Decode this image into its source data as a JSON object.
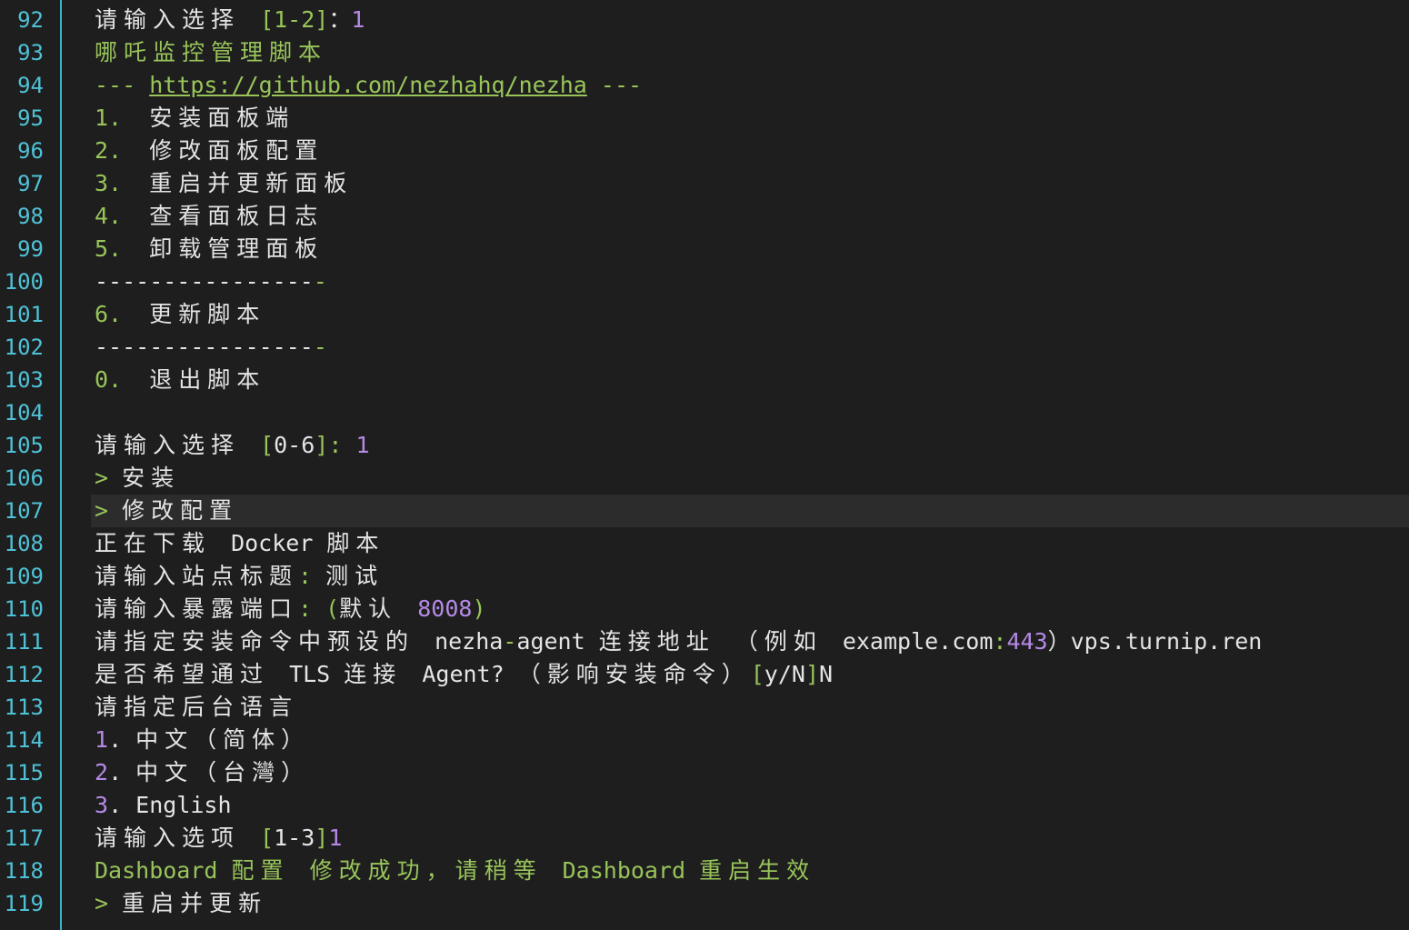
{
  "colors": {
    "background": "#1e1e1e",
    "line_number": "#4fc1d6",
    "gutter_border": "#3ab7c6",
    "text": "#e4e4e4",
    "green": "#98c45a",
    "purple": "#b58ae6",
    "current_line": "#2c2c2c"
  },
  "lines": [
    {
      "n": "92",
      "segs": [
        {
          "t": "请输入选择 ",
          "c": "w",
          "cjk": true
        },
        {
          "t": "[1-2]",
          "c": "g"
        },
        {
          "t": "：",
          "c": "w"
        },
        {
          "t": "1",
          "c": "p"
        }
      ]
    },
    {
      "n": "93",
      "segs": [
        {
          "t": "哪吒监控管理脚本",
          "c": "g",
          "cjk": true
        }
      ]
    },
    {
      "n": "94",
      "segs": [
        {
          "t": "--- ",
          "c": "g"
        },
        {
          "t": "https://github.com/nezhahq/nezha",
          "c": "link"
        },
        {
          "t": " ---",
          "c": "g"
        }
      ]
    },
    {
      "n": "95",
      "segs": [
        {
          "t": "1.  ",
          "c": "g"
        },
        {
          "t": "安装面板端",
          "c": "w",
          "cjk": true
        }
      ]
    },
    {
      "n": "96",
      "segs": [
        {
          "t": "2.  ",
          "c": "g"
        },
        {
          "t": "修改面板配置",
          "c": "w",
          "cjk": true
        }
      ]
    },
    {
      "n": "97",
      "segs": [
        {
          "t": "3.  ",
          "c": "g"
        },
        {
          "t": "重启并更新面板",
          "c": "w",
          "cjk": true
        }
      ]
    },
    {
      "n": "98",
      "segs": [
        {
          "t": "4.  ",
          "c": "g"
        },
        {
          "t": "查看面板日志",
          "c": "w",
          "cjk": true
        }
      ]
    },
    {
      "n": "99",
      "segs": [
        {
          "t": "5.  ",
          "c": "g"
        },
        {
          "t": "卸载管理面板",
          "c": "w",
          "cjk": true
        }
      ]
    },
    {
      "n": "100",
      "segs": [
        {
          "t": "----------------",
          "c": "w"
        },
        {
          "t": "-",
          "c": "g"
        }
      ]
    },
    {
      "n": "101",
      "segs": [
        {
          "t": "6.  ",
          "c": "g"
        },
        {
          "t": "更新脚本",
          "c": "w",
          "cjk": true
        }
      ]
    },
    {
      "n": "102",
      "segs": [
        {
          "t": "----------------",
          "c": "w"
        },
        {
          "t": "-",
          "c": "g"
        }
      ]
    },
    {
      "n": "103",
      "segs": [
        {
          "t": "0.  ",
          "c": "g"
        },
        {
          "t": "退出脚本",
          "c": "w",
          "cjk": true
        }
      ]
    },
    {
      "n": "104",
      "segs": []
    },
    {
      "n": "105",
      "segs": [
        {
          "t": "请输入选择 ",
          "c": "w",
          "cjk": true
        },
        {
          "t": "[",
          "c": "g"
        },
        {
          "t": "0-6",
          "c": "w"
        },
        {
          "t": "]: ",
          "c": "g"
        },
        {
          "t": "1",
          "c": "p"
        }
      ]
    },
    {
      "n": "106",
      "segs": [
        {
          "t": "> ",
          "c": "g"
        },
        {
          "t": "安装",
          "c": "w",
          "cjk": true
        }
      ]
    },
    {
      "n": "107",
      "current": true,
      "segs": [
        {
          "t": "> ",
          "c": "g"
        },
        {
          "t": "修改配置",
          "c": "w",
          "cjk": true
        }
      ]
    },
    {
      "n": "108",
      "segs": [
        {
          "t": "正在下载 ",
          "c": "w",
          "cjk": true
        },
        {
          "t": "Docker ",
          "c": "w"
        },
        {
          "t": "脚本",
          "c": "w",
          "cjk": true
        }
      ]
    },
    {
      "n": "109",
      "segs": [
        {
          "t": "请输入站点标题",
          "c": "w",
          "cjk": true
        },
        {
          "t": ": ",
          "c": "g"
        },
        {
          "t": "测试",
          "c": "w",
          "cjk": true
        }
      ]
    },
    {
      "n": "110",
      "segs": [
        {
          "t": "请输入暴露端口",
          "c": "w",
          "cjk": true
        },
        {
          "t": ": (",
          "c": "g"
        },
        {
          "t": "默认 ",
          "c": "w",
          "cjk": true
        },
        {
          "t": "8008",
          "c": "p"
        },
        {
          "t": ")",
          "c": "g"
        }
      ]
    },
    {
      "n": "111",
      "segs": [
        {
          "t": "请指定安装命令中预设的 ",
          "c": "w",
          "cjk": true
        },
        {
          "t": "nezha",
          "c": "w"
        },
        {
          "t": "-",
          "c": "g"
        },
        {
          "t": "agent ",
          "c": "w"
        },
        {
          "t": "连接地址 （例如 ",
          "c": "w",
          "cjk": true
        },
        {
          "t": "example.com",
          "c": "w"
        },
        {
          "t": ":",
          "c": "g"
        },
        {
          "t": "443",
          "c": "p"
        },
        {
          "t": "）",
          "c": "w"
        },
        {
          "t": "vps.turnip.ren",
          "c": "w"
        }
      ]
    },
    {
      "n": "112",
      "segs": [
        {
          "t": "是否希望通过 ",
          "c": "w",
          "cjk": true
        },
        {
          "t": "TLS ",
          "c": "w"
        },
        {
          "t": "连接 ",
          "c": "w",
          "cjk": true
        },
        {
          "t": "Agent? ",
          "c": "w"
        },
        {
          "t": "（影响安装命令）",
          "c": "w",
          "cjk": true
        },
        {
          "t": "[",
          "c": "g"
        },
        {
          "t": "y/N",
          "c": "w"
        },
        {
          "t": "]",
          "c": "g"
        },
        {
          "t": "N",
          "c": "w"
        }
      ]
    },
    {
      "n": "113",
      "segs": [
        {
          "t": "请指定后台语言",
          "c": "w",
          "cjk": true
        }
      ]
    },
    {
      "n": "114",
      "segs": [
        {
          "t": "1",
          "c": "p"
        },
        {
          "t": ". ",
          "c": "w"
        },
        {
          "t": "中文（简体）",
          "c": "w",
          "cjk": true
        }
      ]
    },
    {
      "n": "115",
      "segs": [
        {
          "t": "2",
          "c": "p"
        },
        {
          "t": ". ",
          "c": "w"
        },
        {
          "t": "中文（台灣）",
          "c": "w",
          "cjk": true
        }
      ]
    },
    {
      "n": "116",
      "segs": [
        {
          "t": "3",
          "c": "p"
        },
        {
          "t": ". English",
          "c": "w"
        }
      ]
    },
    {
      "n": "117",
      "segs": [
        {
          "t": "请输入选项 ",
          "c": "w",
          "cjk": true
        },
        {
          "t": "[",
          "c": "g"
        },
        {
          "t": "1-3",
          "c": "w"
        },
        {
          "t": "]",
          "c": "g"
        },
        {
          "t": "1",
          "c": "p"
        }
      ]
    },
    {
      "n": "118",
      "segs": [
        {
          "t": "Dashboard ",
          "c": "g"
        },
        {
          "t": "配置 修改成功，请稍等 ",
          "c": "g",
          "cjk": true
        },
        {
          "t": "Dashboard ",
          "c": "g"
        },
        {
          "t": "重启生效",
          "c": "g",
          "cjk": true
        }
      ]
    },
    {
      "n": "119",
      "segs": [
        {
          "t": "> ",
          "c": "g"
        },
        {
          "t": "重启并更新",
          "c": "w",
          "cjk": true
        }
      ]
    }
  ]
}
